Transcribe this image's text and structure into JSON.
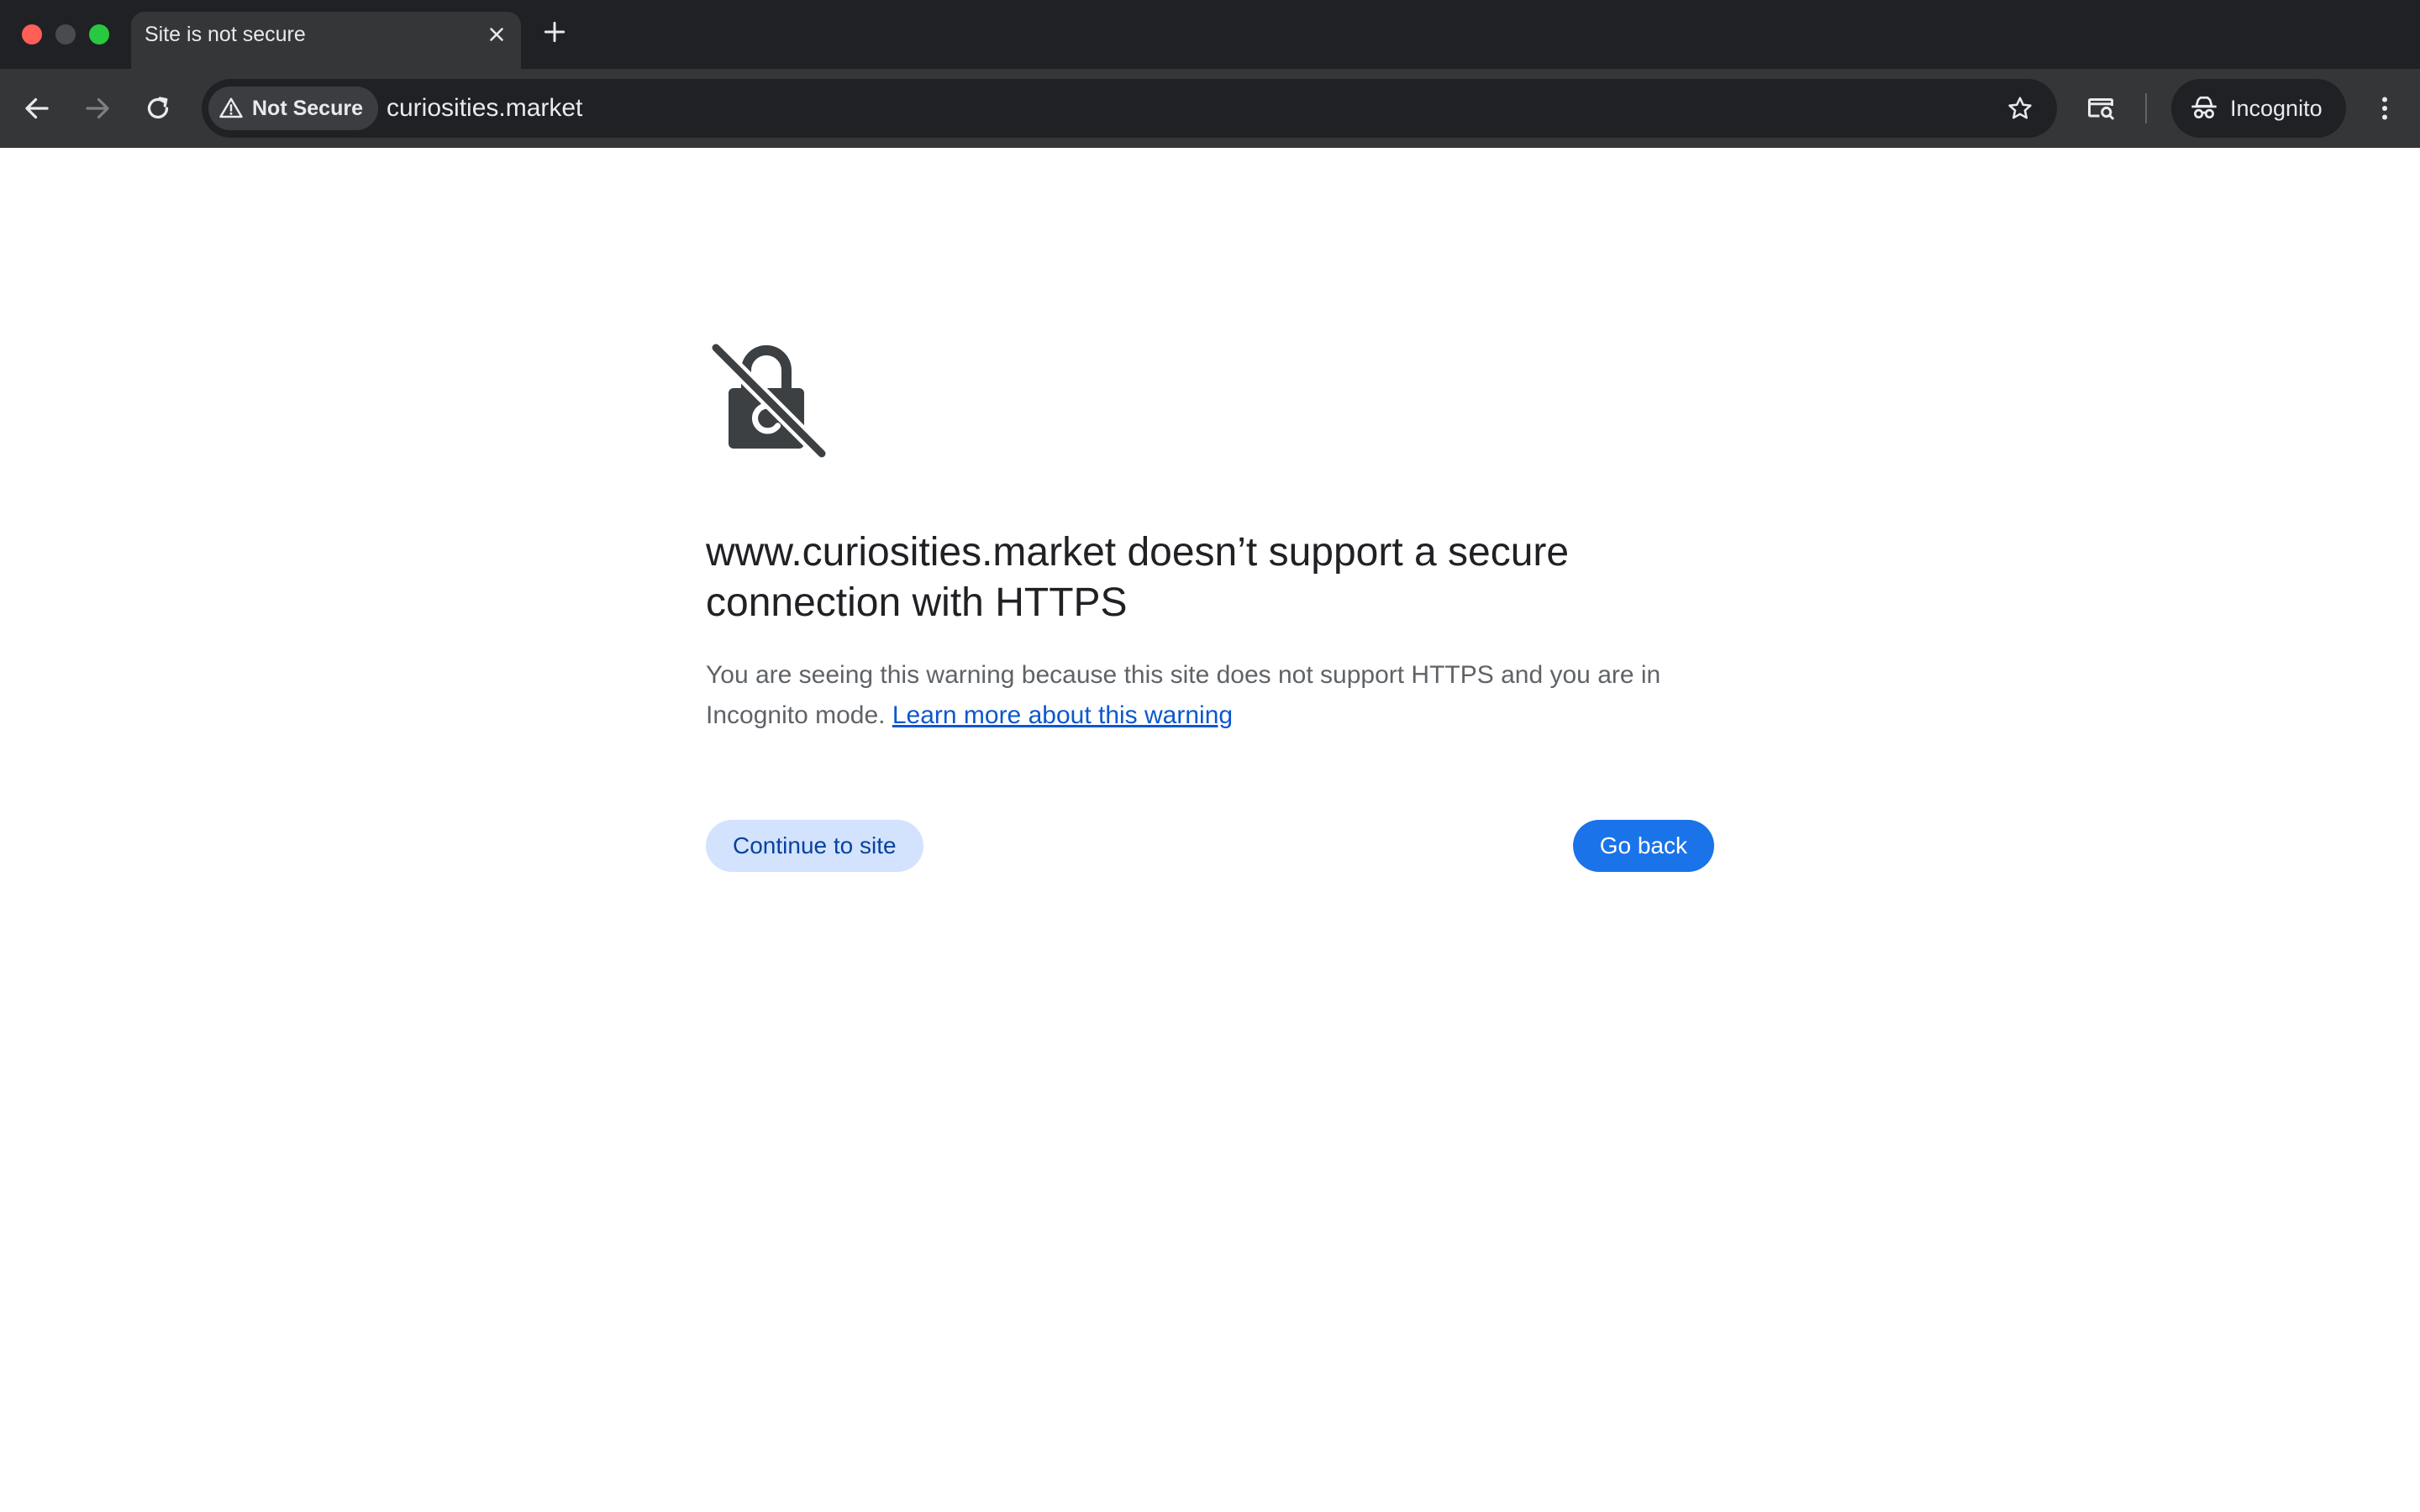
{
  "tab": {
    "title": "Site is not secure"
  },
  "toolbar": {
    "security_chip_label": "Not Secure",
    "url": "curiosities.market",
    "profile_label": "Incognito"
  },
  "page": {
    "heading": "www.curiosities.market doesn’t support a secure connection with HTTPS",
    "description": "You are seeing this warning because this site does not support HTTPS and you are in Incognito mode.",
    "learn_more_link": "Learn more about this warning",
    "continue_button": "Continue to site",
    "back_button": "Go back"
  },
  "icons": {
    "close_tab": "close-icon",
    "new_tab": "plus-icon",
    "back": "arrow-left-icon",
    "forward": "arrow-right-icon",
    "reload": "reload-icon",
    "warning": "warning-triangle-icon",
    "bookmark": "star-icon",
    "tab_search": "tab-search-icon",
    "incognito": "incognito-icon",
    "menu": "kebab-menu-icon",
    "page_lock": "lock-slash-icon"
  },
  "colors": {
    "frame": "#202124",
    "toolbar": "#353638",
    "link": "#0b57d0",
    "primary_button": "#1a73e8",
    "secondary_button": "#d3e3fd"
  }
}
